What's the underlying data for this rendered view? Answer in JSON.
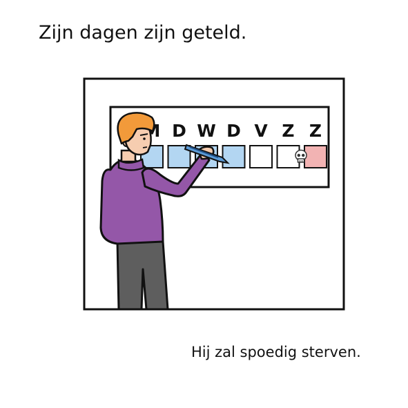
{
  "title": "Zijn dagen zijn geteld.",
  "caption": "Hij zal spoedig sterven.",
  "calendar": {
    "days": [
      {
        "letter": "M",
        "marked": true,
        "icon": ""
      },
      {
        "letter": "D",
        "marked": true,
        "icon": ""
      },
      {
        "letter": "W",
        "marked": true,
        "icon": ""
      },
      {
        "letter": "D",
        "marked": true,
        "icon": ""
      },
      {
        "letter": "V",
        "marked": false,
        "icon": ""
      },
      {
        "letter": "Z",
        "marked": false,
        "icon": ""
      },
      {
        "letter": "Z",
        "marked": false,
        "icon": "skull-icon"
      }
    ]
  },
  "colors": {
    "marked": "#b3d6f2",
    "skull_box": "#f2b3b3",
    "shirt": "#9457a8",
    "hair": "#f29a3a",
    "pants": "#5e5e5e",
    "skin": "#f6cdb0",
    "outline": "#111111"
  }
}
